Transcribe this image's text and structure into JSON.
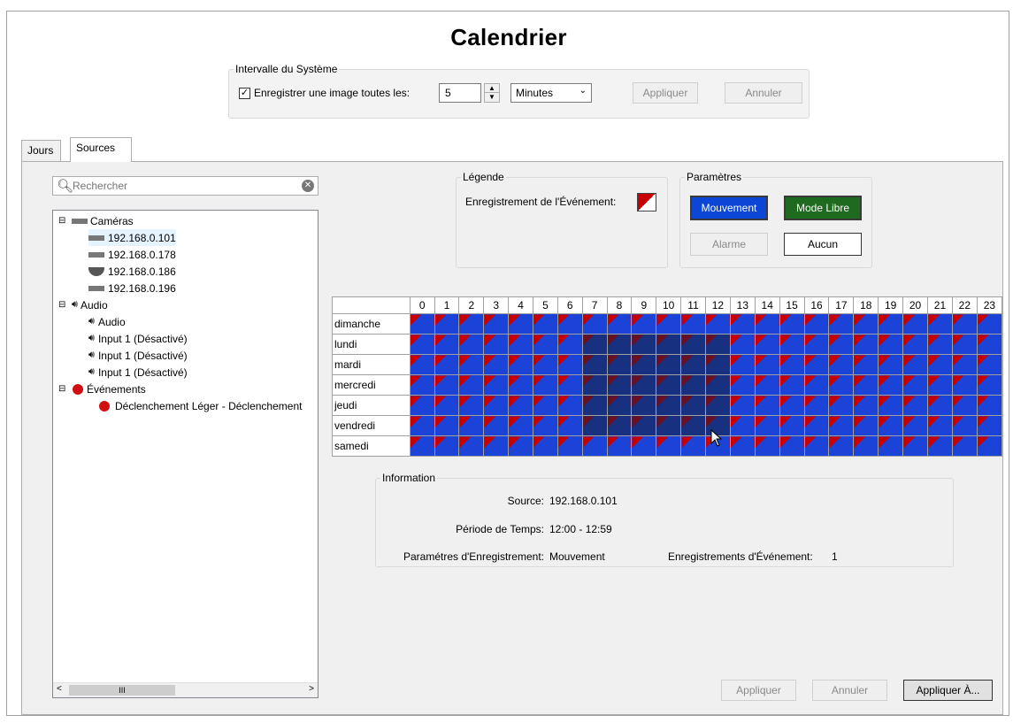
{
  "title": "Calendrier",
  "system_interval": {
    "legend": "Intervalle du Système",
    "checkbox_checked": true,
    "checkbox_label": "Enregistrer une image toutes les:",
    "interval_value": "5",
    "unit_selected": "Minutes",
    "apply_label": "Appliquer",
    "cancel_label": "Annuler"
  },
  "tabs": [
    {
      "label": "Jours",
      "active": false
    },
    {
      "label": "Sources",
      "active": true
    }
  ],
  "search": {
    "placeholder": "Rechercher"
  },
  "tree": {
    "cameras": {
      "label": "Caméras",
      "items": [
        "192.168.0.101",
        "192.168.0.178",
        "192.168.0.186",
        "192.168.0.196"
      ]
    },
    "audio": {
      "label": "Audio",
      "items": [
        "Audio",
        "Input 1 (Désactivé)",
        "Input 1 (Désactivé)",
        "Input 1 (Désactivé)"
      ]
    },
    "events": {
      "label": "Événements",
      "items": [
        "Déclenchement Léger - Déclenchement"
      ]
    },
    "scroll_glyph": "III"
  },
  "legend_box": {
    "title": "Légende",
    "event_recording_label": "Enregistrement de l'Événement:"
  },
  "parameters": {
    "title": "Paramètres",
    "motion_label": "Mouvement",
    "free_mode_label": "Mode Libre",
    "alarm_label": "Alarme",
    "none_label": "Aucun"
  },
  "schedule": {
    "hours": [
      "0",
      "1",
      "2",
      "3",
      "4",
      "5",
      "6",
      "7",
      "8",
      "9",
      "10",
      "11",
      "12",
      "13",
      "14",
      "15",
      "16",
      "17",
      "18",
      "19",
      "20",
      "21",
      "22",
      "23"
    ],
    "days": [
      "dimanche",
      "lundi",
      "mardi",
      "mercredi",
      "jeudi",
      "vendredi",
      "samedi"
    ],
    "selection": {
      "day_from": 1,
      "day_to": 5,
      "hour_from": 7,
      "hour_to": 12
    }
  },
  "information": {
    "title": "Information",
    "source_label": "Source:",
    "source_value": "192.168.0.101",
    "period_label": "Période de Temps:",
    "period_value": "12:00 - 12:59",
    "rec_params_label": "Paramétres d'Enregistrement:",
    "rec_params_value": "Mouvement",
    "event_recs_label": "Enregistrements d'Événement:",
    "event_recs_value": "1"
  },
  "footer": {
    "apply_label": "Appliquer",
    "cancel_label": "Annuler",
    "apply_to_label": "Appliquer À..."
  },
  "colors": {
    "schedule_blue": "#1b43d8",
    "event_red": "#c80000",
    "motion_button": "#0b46d6",
    "free_mode_button": "#1e6a1e"
  }
}
